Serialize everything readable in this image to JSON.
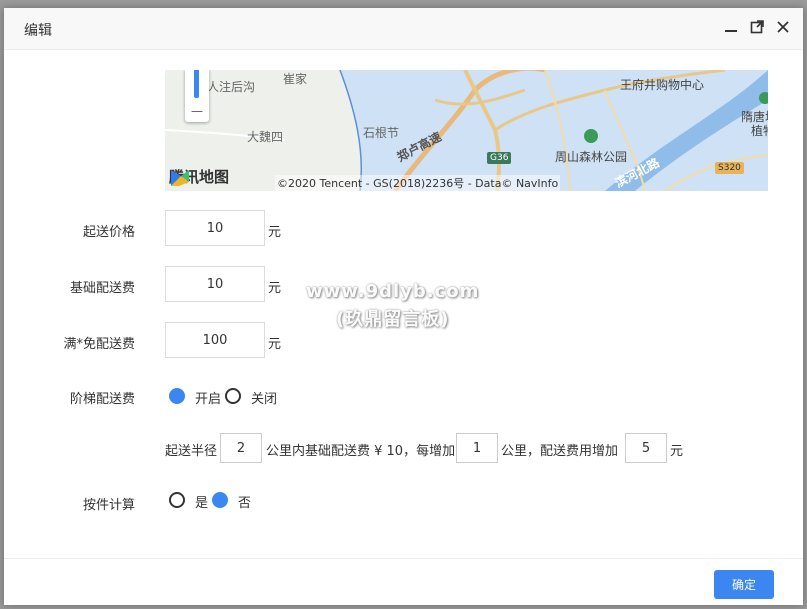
{
  "dialog": {
    "title": "编辑",
    "confirm_label": "确定"
  },
  "map": {
    "labels": {
      "a": "人注后沟",
      "b": "崔家",
      "c": "大魏四",
      "d": "石根节",
      "e": "王府井购物中心",
      "f": "周山森林公园",
      "g": "隋唐城",
      "h": "植物",
      "road1": "郑卢高速",
      "road2": "滨河北路",
      "shield_g36": "G36",
      "shield_s320": "S320"
    },
    "logo_text": "腾讯地图",
    "copyright": "©2020 Tencent - GS(2018)2236号 - Data© NavInfo",
    "colors": {
      "water": "#cfe1f5",
      "land": "#eef0ec",
      "road": "#e8c889",
      "river": "#9cc3ec"
    }
  },
  "form": {
    "min_price": {
      "label": "起送价格",
      "value": "10",
      "unit": "元"
    },
    "base_fee": {
      "label": "基础配送费",
      "value": "10",
      "unit": "元"
    },
    "free_fee": {
      "label": "满*免配送费",
      "value": "100",
      "unit": "元"
    },
    "tiered": {
      "label": "阶梯配送费",
      "on_label": "开启",
      "off_label": "关闭",
      "selected": "on",
      "text1": "起送半径",
      "radius": "2",
      "text2": "公里内基础配送费 ¥ 10，每增加",
      "step_km": "1",
      "text3": "公里，配送费用增加",
      "step_fee": "5",
      "text4": "元"
    },
    "per_item": {
      "label": "按件计算",
      "yes_label": "是",
      "no_label": "否",
      "selected": "no"
    }
  },
  "watermark": {
    "line1": "www.9dlyb.com",
    "line2": "(玖鼎留言板)"
  },
  "colors": {
    "accent": "#3b86f0"
  }
}
